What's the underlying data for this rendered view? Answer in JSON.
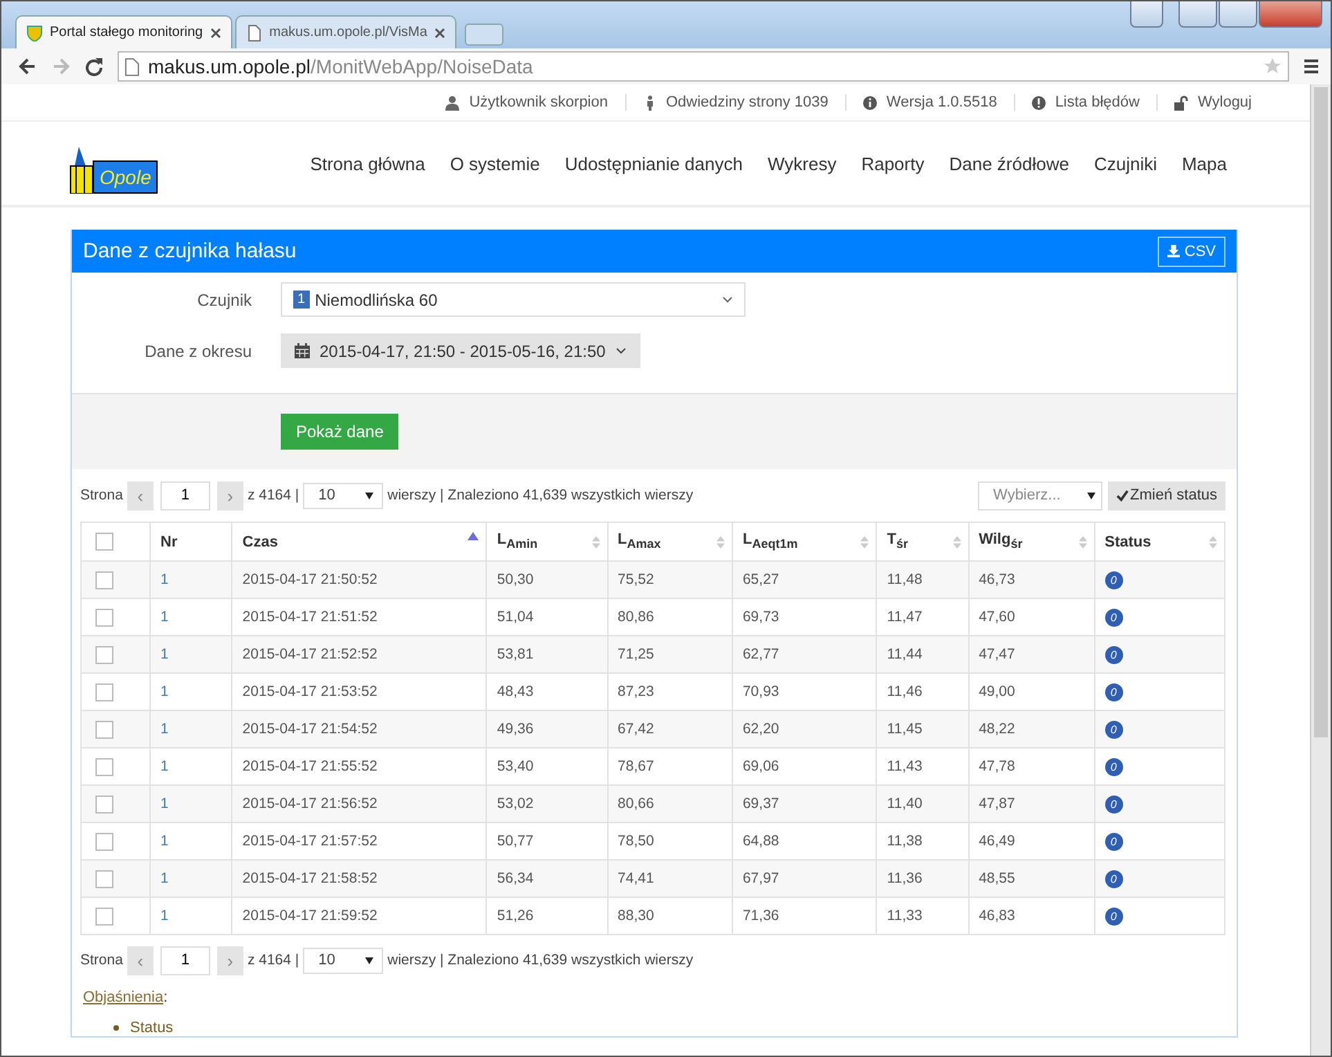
{
  "browser": {
    "tabs": [
      {
        "title": "Portal stałego monitoring",
        "selected": true
      },
      {
        "title": "makus.um.opole.pl/VisMa",
        "selected": false
      }
    ],
    "address": {
      "host": "makus.um.opole.pl",
      "path": "/MonitWebApp/NoiseData"
    }
  },
  "top_links": [
    {
      "label": "Użytkownik skorpion"
    },
    {
      "label": "Odwiedziny strony 1039"
    },
    {
      "label": "Wersja 1.0.5518"
    },
    {
      "label": "Lista błędów"
    },
    {
      "label": "Wyloguj"
    }
  ],
  "logo": {
    "text": "Opole"
  },
  "nav": [
    "Strona główna",
    "O systemie",
    "Udostępnianie danych",
    "Wykresy",
    "Raporty",
    "Dane źródłowe",
    "Czujniki",
    "Mapa"
  ],
  "panel": {
    "title": "Dane z czujnika hałasu",
    "csv_button": "CSV",
    "sensor": {
      "label": "Czujnik",
      "badge": "1",
      "value": "Niemodlińska 60"
    },
    "period": {
      "label": "Dane z okresu",
      "value": "2015-04-17, 21:50 - 2015-05-16, 21:50"
    },
    "show_button": "Pokaż dane"
  },
  "pager_top": {
    "label": "Strona",
    "prev": "‹",
    "next": "›",
    "page": "1",
    "of": "z 4164 |",
    "per_page": "10",
    "found": "wierszy | Znaleziono 41,639 wszystkich wierszy"
  },
  "bulk": {
    "placeholder": "Wybierz...",
    "button": "Zmień status"
  },
  "table": {
    "header_checked": false,
    "columns": [
      {
        "label": "Nr",
        "sortable": false,
        "sorted": false
      },
      {
        "label": "Czas",
        "sortable": true,
        "sorted": true
      },
      {
        "label": "L$_{Amin}$",
        "sortable": true,
        "sorted": false
      },
      {
        "label": "L$_{Amax}$",
        "sortable": true,
        "sorted": false
      },
      {
        "label": "L$_{Aeqt1m}$",
        "sortable": true,
        "sorted": false
      },
      {
        "label": "T$_{śr}$",
        "sortable": true,
        "sorted": false
      },
      {
        "label": "Wilg$_{śr}$",
        "sortable": true,
        "sorted": false
      },
      {
        "label": "Status",
        "sortable": true,
        "sorted": false
      }
    ],
    "rows": [
      {
        "checked": false,
        "nr": "1",
        "time": "2015-04-17 21:50:52",
        "lamin": "50,30",
        "lamax": "75,52",
        "laeq": "65,27",
        "t": "11,48",
        "wilg": "46,73",
        "status": "0"
      },
      {
        "checked": false,
        "nr": "1",
        "time": "2015-04-17 21:51:52",
        "lamin": "51,04",
        "lamax": "80,86",
        "laeq": "69,73",
        "t": "11,47",
        "wilg": "47,60",
        "status": "0"
      },
      {
        "checked": false,
        "nr": "1",
        "time": "2015-04-17 21:52:52",
        "lamin": "53,81",
        "lamax": "71,25",
        "laeq": "62,77",
        "t": "11,44",
        "wilg": "47,47",
        "status": "0"
      },
      {
        "checked": false,
        "nr": "1",
        "time": "2015-04-17 21:53:52",
        "lamin": "48,43",
        "lamax": "87,23",
        "laeq": "70,93",
        "t": "11,46",
        "wilg": "49,00",
        "status": "0"
      },
      {
        "checked": false,
        "nr": "1",
        "time": "2015-04-17 21:54:52",
        "lamin": "49,36",
        "lamax": "67,42",
        "laeq": "62,20",
        "t": "11,45",
        "wilg": "48,22",
        "status": "0"
      },
      {
        "checked": false,
        "nr": "1",
        "time": "2015-04-17 21:55:52",
        "lamin": "53,40",
        "lamax": "78,67",
        "laeq": "69,06",
        "t": "11,43",
        "wilg": "47,78",
        "status": "0"
      },
      {
        "checked": false,
        "nr": "1",
        "time": "2015-04-17 21:56:52",
        "lamin": "53,02",
        "lamax": "80,66",
        "laeq": "69,37",
        "t": "11,40",
        "wilg": "47,87",
        "status": "0"
      },
      {
        "checked": false,
        "nr": "1",
        "time": "2015-04-17 21:57:52",
        "lamin": "50,77",
        "lamax": "78,50",
        "laeq": "64,88",
        "t": "11,38",
        "wilg": "46,49",
        "status": "0"
      },
      {
        "checked": false,
        "nr": "1",
        "time": "2015-04-17 21:58:52",
        "lamin": "56,34",
        "lamax": "74,41",
        "laeq": "67,97",
        "t": "11,36",
        "wilg": "48,55",
        "status": "0"
      },
      {
        "checked": false,
        "nr": "1",
        "time": "2015-04-17 21:59:52",
        "lamin": "51,26",
        "lamax": "88,30",
        "laeq": "71,36",
        "t": "11,33",
        "wilg": "46,83",
        "status": "0"
      }
    ]
  },
  "pager_bottom": {
    "label": "Strona",
    "prev": "‹",
    "next": "›",
    "page": "1",
    "of": "z 4164 |",
    "per_page": "10",
    "found": "wierszy | Znaleziono 41,639 wszystkich wierszy"
  },
  "legend": {
    "link": "Objaśnienia",
    "suffix": ":",
    "items": [
      "Status"
    ]
  }
}
